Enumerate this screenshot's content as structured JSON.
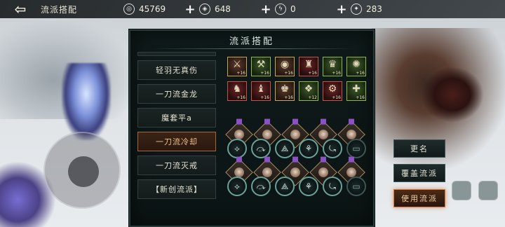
{
  "topbar": {
    "back_icon": "back-arrow-icon",
    "title": "流派搭配",
    "resources": [
      {
        "icon": "coin-icon",
        "glyph": "◎",
        "value": "45769"
      },
      {
        "icon": "ingot-icon",
        "glyph": "◈",
        "value": "648"
      },
      {
        "icon": "stamina-bolt-icon",
        "glyph": "ϟ",
        "value": "0"
      },
      {
        "icon": "ticket-icon",
        "glyph": "✦",
        "value": "283"
      }
    ],
    "plus": "+"
  },
  "panel": {
    "title": "流派搭配",
    "schools": [
      {
        "label": "轻羽无真伤",
        "active": false
      },
      {
        "label": "一刀流金龙",
        "active": false
      },
      {
        "label": "魔套平a",
        "active": false
      },
      {
        "label": "一刀流冷却",
        "active": true
      },
      {
        "label": "一刀流灭戒",
        "active": false
      },
      {
        "label": "【新创流派】",
        "active": false
      }
    ],
    "equipment": [
      {
        "level": "+16",
        "variant": "",
        "glyph": "⚔"
      },
      {
        "level": "+16",
        "variant": "g",
        "glyph": "⚒"
      },
      {
        "level": "+16",
        "variant": "",
        "glyph": "◉"
      },
      {
        "level": "+16",
        "variant": "r",
        "glyph": "♜"
      },
      {
        "level": "+16",
        "variant": "g",
        "glyph": "♛"
      },
      {
        "level": "+16",
        "variant": "g",
        "glyph": "✺"
      },
      {
        "level": "+16",
        "variant": "r",
        "glyph": "♞"
      },
      {
        "level": "+16",
        "variant": "r",
        "glyph": "♝"
      },
      {
        "level": "+16",
        "variant": "",
        "glyph": "♚"
      },
      {
        "level": "+12",
        "variant": "g",
        "glyph": "❖"
      },
      {
        "level": "+16",
        "variant": "r",
        "glyph": "⚙"
      },
      {
        "level": "+16",
        "variant": "g",
        "glyph": "✚"
      }
    ],
    "skill_groups": [
      {
        "portraits": 5,
        "rings": [
          "⟡",
          "⤼",
          "⟁",
          "⚘",
          "⤿",
          "▭"
        ]
      },
      {
        "portraits": 5,
        "rings": [
          "⟡",
          "⤼",
          "⟁",
          "⚘",
          "⤿",
          "▭"
        ]
      }
    ]
  },
  "side_buttons": {
    "rename": "更名",
    "overwrite": "覆盖流派",
    "use": "使用流派"
  }
}
